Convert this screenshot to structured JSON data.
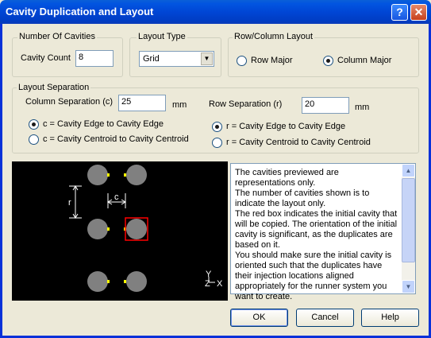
{
  "window": {
    "title": "Cavity Duplication and Layout"
  },
  "number_of_cavities": {
    "group_label": "Number Of Cavities",
    "count_label": "Cavity Count",
    "count_value": "8"
  },
  "layout_type": {
    "group_label": "Layout Type",
    "selected": "Grid"
  },
  "row_column_layout": {
    "group_label": "Row/Column Layout",
    "row_major": "Row Major",
    "column_major": "Column Major",
    "selected": "column_major"
  },
  "layout_separation": {
    "group_label": "Layout Separation",
    "column_label": "Column Separation (c)",
    "column_value": "25",
    "column_unit": "mm",
    "row_label": "Row Separation (r)",
    "row_value": "20",
    "row_unit": "mm",
    "c_edge": "c = Cavity Edge to Cavity Edge",
    "c_centroid": "c = Cavity Centroid to Cavity Centroid",
    "r_edge": "r = Cavity Edge to Cavity Edge",
    "r_centroid": "r = Cavity Centroid to Cavity Centroid",
    "c_selected": "edge",
    "r_selected": "edge"
  },
  "preview": {
    "r_label": "r",
    "c_label": "c",
    "axis_y": "Y",
    "axis_z": "Z",
    "axis_x": "X"
  },
  "info_text": [
    "The cavities previewed are representations only.",
    "The number of cavities shown is to indicate the layout only.",
    "The red box indicates the initial cavity that will be copied. The orientation of the initial cavity is significant, as the duplicates are based on it.",
    "You should make sure the initial cavity is oriented such that the duplicates have their injection locations aligned appropriately for the runner system you want to create."
  ],
  "buttons": {
    "ok": "OK",
    "cancel": "Cancel",
    "help": "Help"
  },
  "colors": {
    "title_bar": "#0046d5",
    "cavity": "#808080",
    "gate": "#ffff00",
    "highlight_box": "#ff0000"
  }
}
